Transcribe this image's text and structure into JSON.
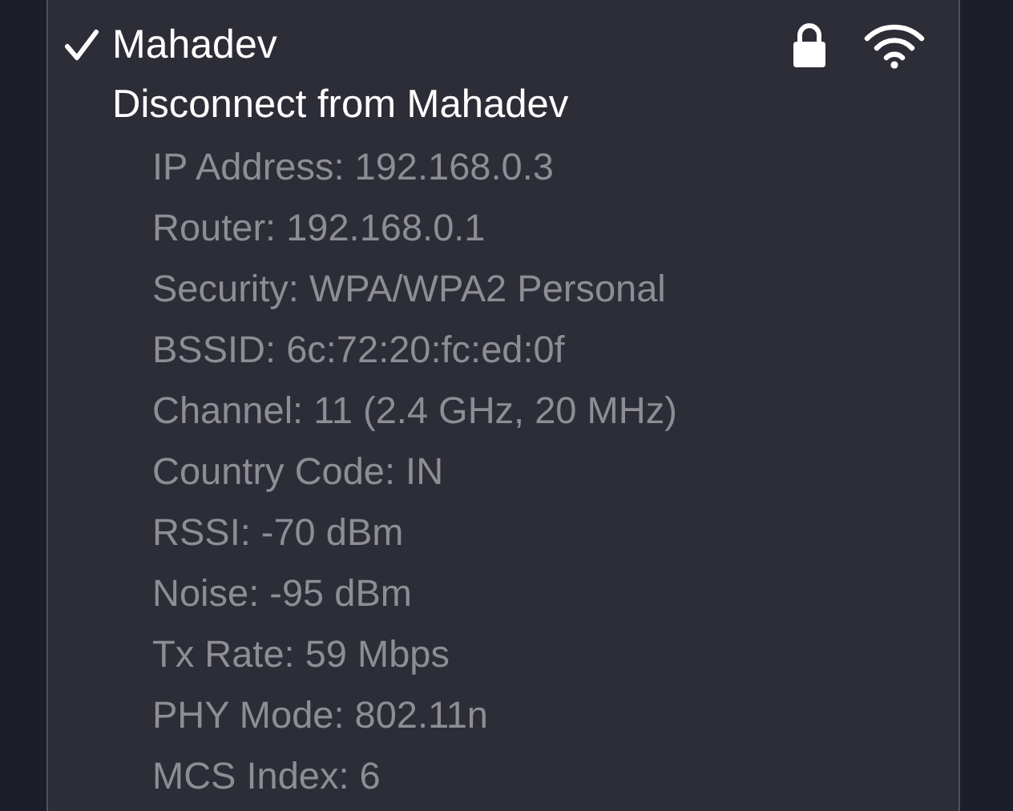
{
  "network": {
    "name": "Mahadev",
    "selected": true,
    "secure": true
  },
  "action": "Disconnect from Mahadev",
  "details": [
    "IP Address: 192.168.0.3",
    "Router: 192.168.0.1",
    "Security: WPA/WPA2 Personal",
    "BSSID: 6c:72:20:fc:ed:0f",
    "Channel: 11 (2.4 GHz, 20 MHz)",
    "Country Code: IN",
    "RSSI: -70 dBm",
    "Noise: -95 dBm",
    "Tx Rate: 59 Mbps",
    "PHY Mode: 802.11n",
    "MCS Index: 6"
  ]
}
